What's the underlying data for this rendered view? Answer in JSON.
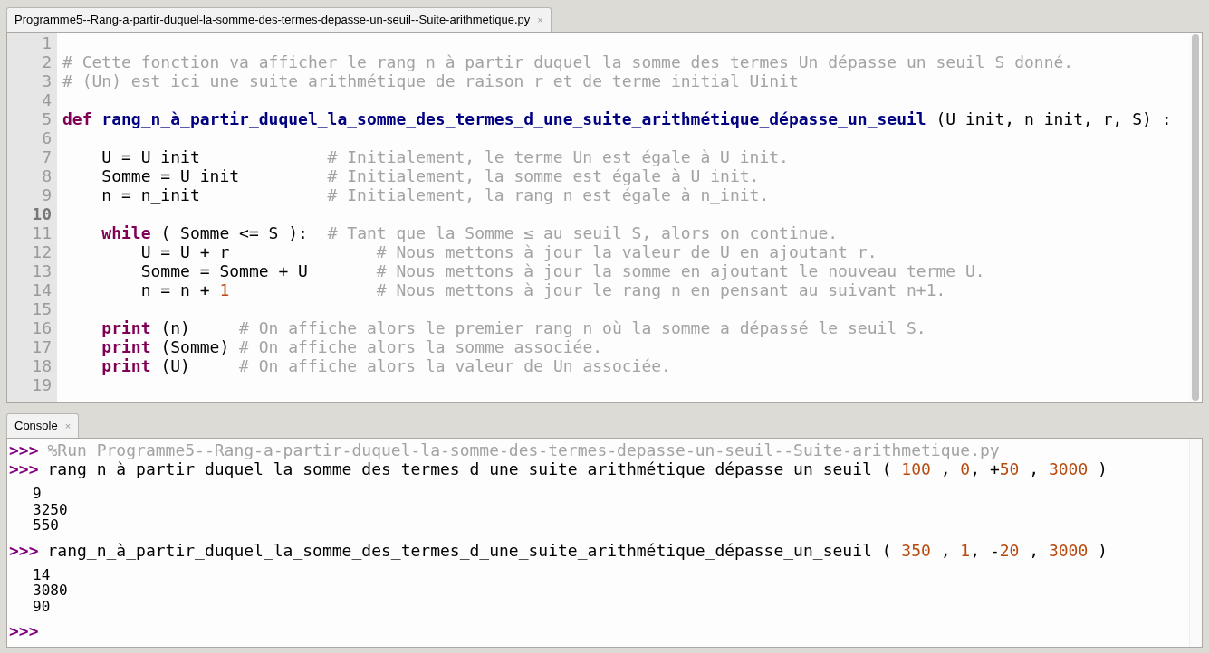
{
  "editor": {
    "tab": {
      "title": "Programme5--Rang-a-partir-duquel-la-somme-des-termes-depasse-un-seuil--Suite-arithmetique.py",
      "close": "×"
    },
    "lines": [
      {
        "number": "1",
        "current": false
      },
      {
        "number": "2",
        "current": false,
        "tokens": [
          {
            "kind": "comment",
            "text": "# Cette fonction va afficher le rang n à partir duquel la somme des termes Un dépasse un seuil S donné."
          }
        ]
      },
      {
        "number": "3",
        "current": false,
        "tokens": [
          {
            "kind": "comment",
            "text": "# (Un) est ici une suite arithmétique de raison r et de terme initial Uinit"
          }
        ]
      },
      {
        "number": "4",
        "current": false
      },
      {
        "number": "5",
        "current": false,
        "tokens": [
          {
            "kind": "keyword",
            "text": "def"
          },
          {
            "kind": "funcname",
            "text": " rang_n_à_partir_duquel_la_somme_des_termes_d_une_suite_arithmétique_dépasse_un_seuil"
          },
          {
            "kind": "plain",
            "text": " (U_init, n_init, r, S) :"
          }
        ]
      },
      {
        "number": "6",
        "current": false
      },
      {
        "number": "7",
        "current": false,
        "tokens": [
          {
            "kind": "plain",
            "text": "    U = U_init             "
          },
          {
            "kind": "comment",
            "text": "# Initialement, le terme Un est égale à U_init."
          }
        ]
      },
      {
        "number": "8",
        "current": false,
        "tokens": [
          {
            "kind": "plain",
            "text": "    Somme = U_init         "
          },
          {
            "kind": "comment",
            "text": "# Initialement, la somme est égale à U_init."
          }
        ]
      },
      {
        "number": "9",
        "current": false,
        "tokens": [
          {
            "kind": "plain",
            "text": "    n = n_init             "
          },
          {
            "kind": "comment",
            "text": "# Initialement, la rang n est égale à n_init."
          }
        ]
      },
      {
        "number": "10",
        "current": true
      },
      {
        "number": "11",
        "current": false,
        "tokens": [
          {
            "kind": "keyword",
            "text": "    while"
          },
          {
            "kind": "plain",
            "text": " ( Somme <= S ):  "
          },
          {
            "kind": "comment",
            "text": "# Tant que la Somme ≤ au seuil S, alors on continue."
          }
        ]
      },
      {
        "number": "12",
        "current": false,
        "tokens": [
          {
            "kind": "plain",
            "text": "        U = U + r               "
          },
          {
            "kind": "comment",
            "text": "# Nous mettons à jour la valeur de U en ajoutant r."
          }
        ]
      },
      {
        "number": "13",
        "current": false,
        "tokens": [
          {
            "kind": "plain",
            "text": "        Somme = Somme + U       "
          },
          {
            "kind": "comment",
            "text": "# Nous mettons à jour la somme en ajoutant le nouveau terme U."
          }
        ]
      },
      {
        "number": "14",
        "current": false,
        "tokens": [
          {
            "kind": "plain",
            "text": "        n = n + "
          },
          {
            "kind": "number",
            "text": "1"
          },
          {
            "kind": "comment",
            "text": "               # Nous mettons à jour le rang n en pensant au suivant n+1."
          }
        ]
      },
      {
        "number": "15",
        "current": false
      },
      {
        "number": "16",
        "current": false,
        "tokens": [
          {
            "kind": "keyword",
            "text": "    print"
          },
          {
            "kind": "plain",
            "text": " (n)     "
          },
          {
            "kind": "comment",
            "text": "# On affiche alors le premier rang n où la somme a dépassé le seuil S."
          }
        ]
      },
      {
        "number": "17",
        "current": false,
        "tokens": [
          {
            "kind": "keyword",
            "text": "    print"
          },
          {
            "kind": "plain",
            "text": " (Somme) "
          },
          {
            "kind": "comment",
            "text": "# On affiche alors la somme associée."
          }
        ]
      },
      {
        "number": "18",
        "current": false,
        "tokens": [
          {
            "kind": "keyword",
            "text": "    print"
          },
          {
            "kind": "plain",
            "text": " (U)     "
          },
          {
            "kind": "comment",
            "text": "# On affiche alors la valeur de Un associée."
          }
        ]
      },
      {
        "number": "19",
        "current": false
      }
    ]
  },
  "console": {
    "tab": {
      "title": "Console",
      "close": "×"
    },
    "entries": [
      {
        "kind": "input",
        "prompt": ">>>",
        "tokens": [
          {
            "kind": "comment",
            "text": "%Run Programme5--Rang-a-partir-duquel-la-somme-des-termes-depasse-un-seuil--Suite-arithmetique.py"
          }
        ]
      },
      {
        "kind": "input",
        "prompt": ">>>",
        "tokens": [
          {
            "kind": "plain",
            "text": "rang_n_à_partir_duquel_la_somme_des_termes_d_une_suite_arithmétique_dépasse_un_seuil ( "
          },
          {
            "kind": "number",
            "text": "100"
          },
          {
            "kind": "plain",
            "text": " , "
          },
          {
            "kind": "number",
            "text": "0"
          },
          {
            "kind": "plain",
            "text": ", +"
          },
          {
            "kind": "number",
            "text": "50"
          },
          {
            "kind": "plain",
            "text": " , "
          },
          {
            "kind": "number",
            "text": "3000"
          },
          {
            "kind": "plain",
            "text": " )"
          }
        ]
      },
      {
        "kind": "output",
        "lines": [
          "9",
          "3250",
          "550"
        ]
      },
      {
        "kind": "input",
        "prompt": ">>>",
        "tokens": [
          {
            "kind": "plain",
            "text": "rang_n_à_partir_duquel_la_somme_des_termes_d_une_suite_arithmétique_dépasse_un_seuil ( "
          },
          {
            "kind": "number",
            "text": "350"
          },
          {
            "kind": "plain",
            "text": " , "
          },
          {
            "kind": "number",
            "text": "1"
          },
          {
            "kind": "plain",
            "text": ", -"
          },
          {
            "kind": "number",
            "text": "20"
          },
          {
            "kind": "plain",
            "text": " , "
          },
          {
            "kind": "number",
            "text": "3000"
          },
          {
            "kind": "plain",
            "text": " )"
          }
        ]
      },
      {
        "kind": "output",
        "lines": [
          "14",
          "3080",
          "90"
        ]
      },
      {
        "kind": "input",
        "prompt": ">>>"
      }
    ]
  }
}
